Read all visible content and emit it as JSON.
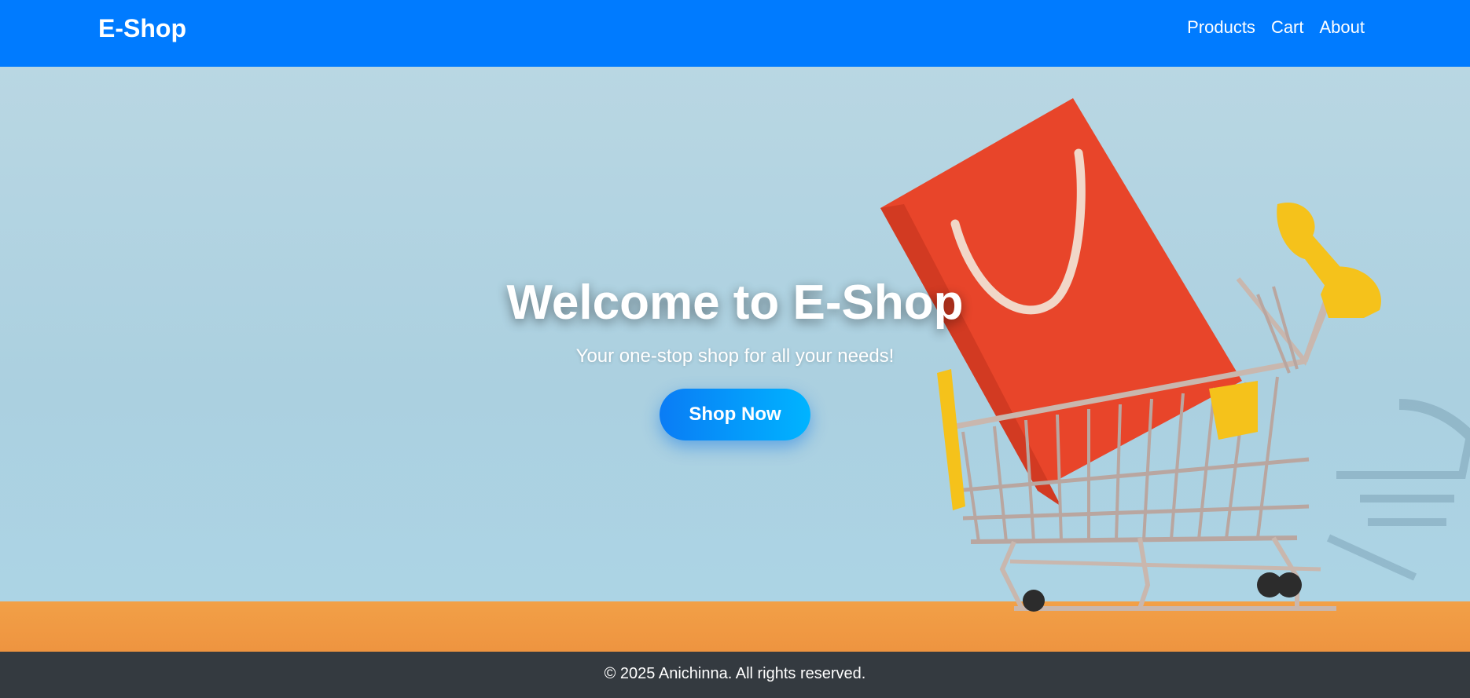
{
  "header": {
    "brand": "E-Shop",
    "nav": [
      {
        "label": "Products"
      },
      {
        "label": "Cart"
      },
      {
        "label": "About"
      }
    ]
  },
  "hero": {
    "title": "Welcome to E-Shop",
    "subtitle": "Your one-stop shop for all your needs!",
    "cta_label": "Shop Now",
    "image_icon": "shopping-cart-with-bag"
  },
  "footer": {
    "copyright": "© 2025 Anichinna. All rights reserved."
  },
  "colors": {
    "header_bg": "#007bff",
    "hero_sky": "#abd0e0",
    "hero_floor": "#f09a44",
    "cta_gradient": [
      "#0a7cf5",
      "#00b4ff"
    ],
    "footer_bg": "#343a40"
  }
}
